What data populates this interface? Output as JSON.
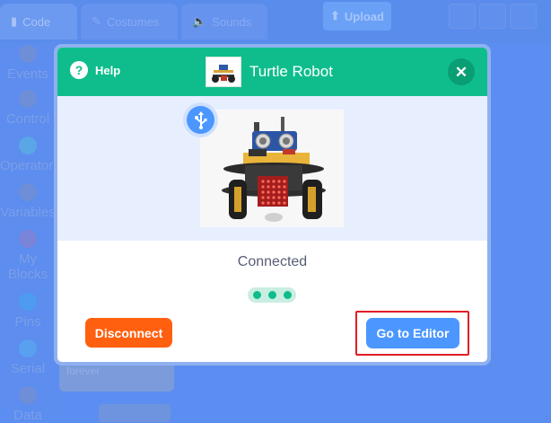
{
  "background": {
    "tabs": [
      {
        "label": "Code",
        "icon": "code-icon"
      },
      {
        "label": "Costumes",
        "icon": "brush-icon"
      },
      {
        "label": "Sounds",
        "icon": "speaker-icon"
      }
    ],
    "upload_label": "Upload",
    "categories": [
      "Events",
      "Control",
      "Operators",
      "Variables",
      "My Blocks",
      "Pins",
      "Serial",
      "Data"
    ],
    "block_label": "forever"
  },
  "modal": {
    "help_label": "Help",
    "title": "Turtle Robot",
    "close_icon": "close-icon",
    "connection_icon": "usb-icon",
    "status": "Connected",
    "disconnect_label": "Disconnect",
    "editor_label": "Go to Editor"
  },
  "colors": {
    "header": "#0fbd8c",
    "disconnect": "#ff6010",
    "primary": "#4c97ff",
    "highlight": "#e11c26"
  }
}
